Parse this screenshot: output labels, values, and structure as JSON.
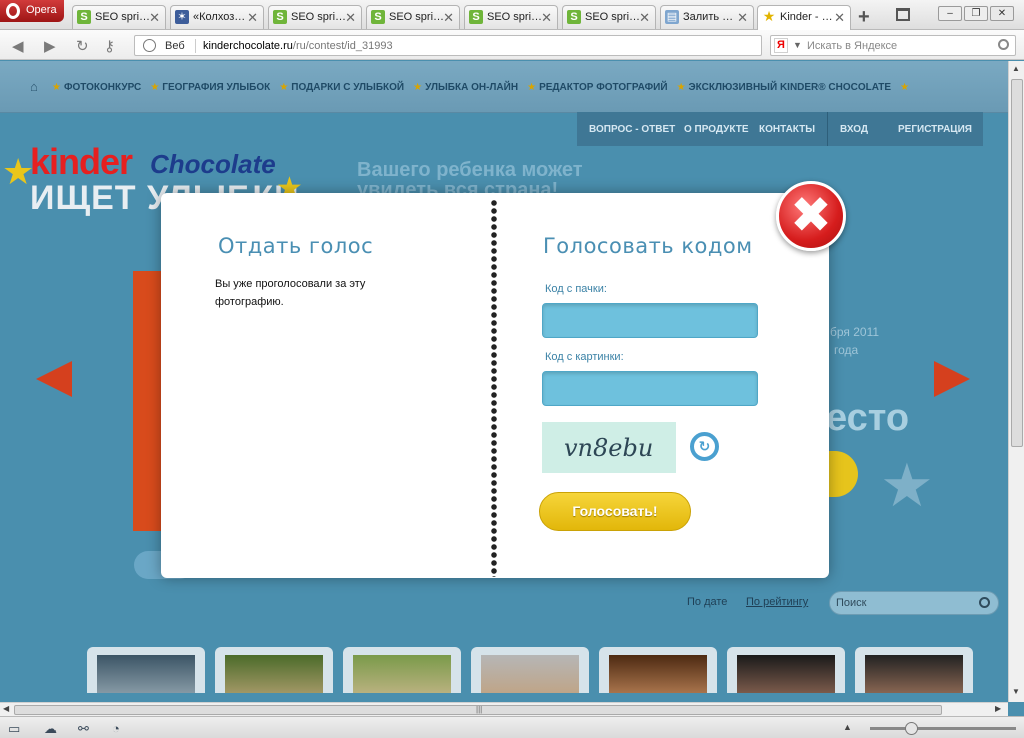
{
  "browser": {
    "menu_label": "Opera",
    "tabs": [
      {
        "title": "SEO spri…",
        "icon": "seo-sprint-icon"
      },
      {
        "title": "«Колхоз…",
        "icon": "kolkhoz-icon"
      },
      {
        "title": "SEO spri…",
        "icon": "seo-sprint-icon"
      },
      {
        "title": "SEO spri…",
        "icon": "seo-sprint-icon"
      },
      {
        "title": "SEO spri…",
        "icon": "seo-sprint-icon"
      },
      {
        "title": "SEO spri…",
        "icon": "seo-sprint-icon"
      },
      {
        "title": "Залить …",
        "icon": "upload-icon"
      },
      {
        "title": "Kinder - …",
        "icon": "star-icon"
      }
    ],
    "new_tab": "+",
    "window_buttons": {
      "minimize": "–",
      "restore": "❐",
      "close": "✕"
    },
    "address": {
      "scheme_label": "Веб",
      "url_host": "kinderchocolate.ru",
      "url_path": "/ru/contest/id_31993"
    },
    "search": {
      "engine_letter": "Я",
      "placeholder": "Искать в Яндексе"
    }
  },
  "site": {
    "top_nav": [
      "ФОТОКОНКУРС",
      "ГЕОГРАФИЯ УЛЫБОК",
      "ПОДАРКИ С УЛЫБКОЙ",
      "УЛЫБКА ОН-ЛАЙН",
      "РЕДАКТОР ФОТОГРАФИЙ",
      "ЭКСКЛЮЗИВНЫЙ KINDER® CHOCOLATE"
    ],
    "secondary_nav": {
      "faq": "ВОПРОС - ОТВЕТ",
      "about": "О ПРОДУКТЕ",
      "contacts": "КОНТАКТЫ",
      "login": "ВХОД",
      "register": "РЕГИСТРАЦИЯ"
    },
    "logo": {
      "brand": "kinder",
      "subbrand": "Chocolate",
      "slogan": "ИЩЕТ УЛЫБКИ"
    },
    "promo_line1": "Вашего ребенка может",
    "promo_line2": "увидеть вся страна!",
    "bg_date": "бря 2011",
    "bg_year": "года",
    "bg_place": "есто",
    "sort_by_date": "По дате",
    "sort_by_rating": "По рейтингу",
    "search_placeholder": "Поиск"
  },
  "modal": {
    "left_title": "Отдать голос",
    "message": "Вы уже проголосовали за эту фотографию.",
    "right_title": "Голосовать кодом",
    "pack_code_label": "Код с пачки:",
    "pack_code_value": "",
    "captcha_label": "Код с картинки:",
    "captcha_value": "",
    "captcha_text": "vn8ebu",
    "vote_button": "Голосовать!",
    "close_symbol": "✖"
  },
  "colors": {
    "accent_blue": "#4a8fb3",
    "page_bg": "#4a8fae",
    "input_fill": "#6ec1dd",
    "vote_yellow": "#f1cc24",
    "close_red": "#d61d1d"
  }
}
